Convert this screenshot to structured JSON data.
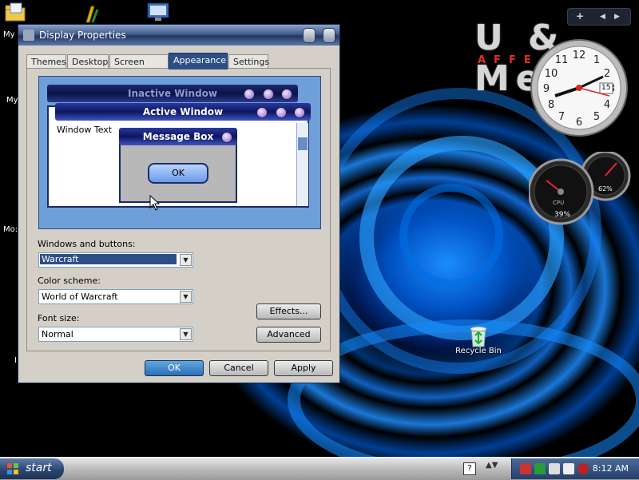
{
  "desktop": {
    "icons": [
      {
        "name": "my-documents",
        "label": "My"
      },
      {
        "name": "my-computer",
        "label": "My"
      },
      {
        "name": "mozilla",
        "label": "Mo:"
      },
      {
        "name": "unknown-item",
        "label": "I"
      },
      {
        "name": "recycle-bin",
        "label": "Recycle Bin"
      }
    ],
    "brand": {
      "text": "U & Me",
      "subtitle": "AFFE"
    }
  },
  "window": {
    "title": "Display Properties",
    "tabs": [
      "Themes",
      "Desktop",
      "Screen Saver",
      "Appearance",
      "Settings"
    ],
    "active_tab": "Appearance",
    "preview": {
      "inactive_title": "Inactive Window",
      "active_title": "Active Window",
      "window_text": "Window Text",
      "message_box_title": "Message Box",
      "ok_label": "OK"
    },
    "windows_buttons": {
      "label": "Windows and buttons:",
      "value": "Warcraft"
    },
    "color_scheme": {
      "label": "Color scheme:",
      "value": "World of Warcraft"
    },
    "font_size": {
      "label": "Font size:",
      "value": "Normal"
    },
    "effects_label": "Effects...",
    "advanced_label": "Advanced",
    "ok_label": "OK",
    "cancel_label": "Cancel",
    "apply_label": "Apply"
  },
  "gadgets": {
    "clock": {
      "date": "15"
    },
    "gauges": {
      "cpu_label": "CPU",
      "cpu_percent": "39%",
      "mem_percent": "62%"
    }
  },
  "taskbar": {
    "start_label": "start",
    "time": "8:12 AM"
  },
  "colors": {
    "accent": "#2d4f86",
    "desktop_swirl": "#1a8cff"
  }
}
